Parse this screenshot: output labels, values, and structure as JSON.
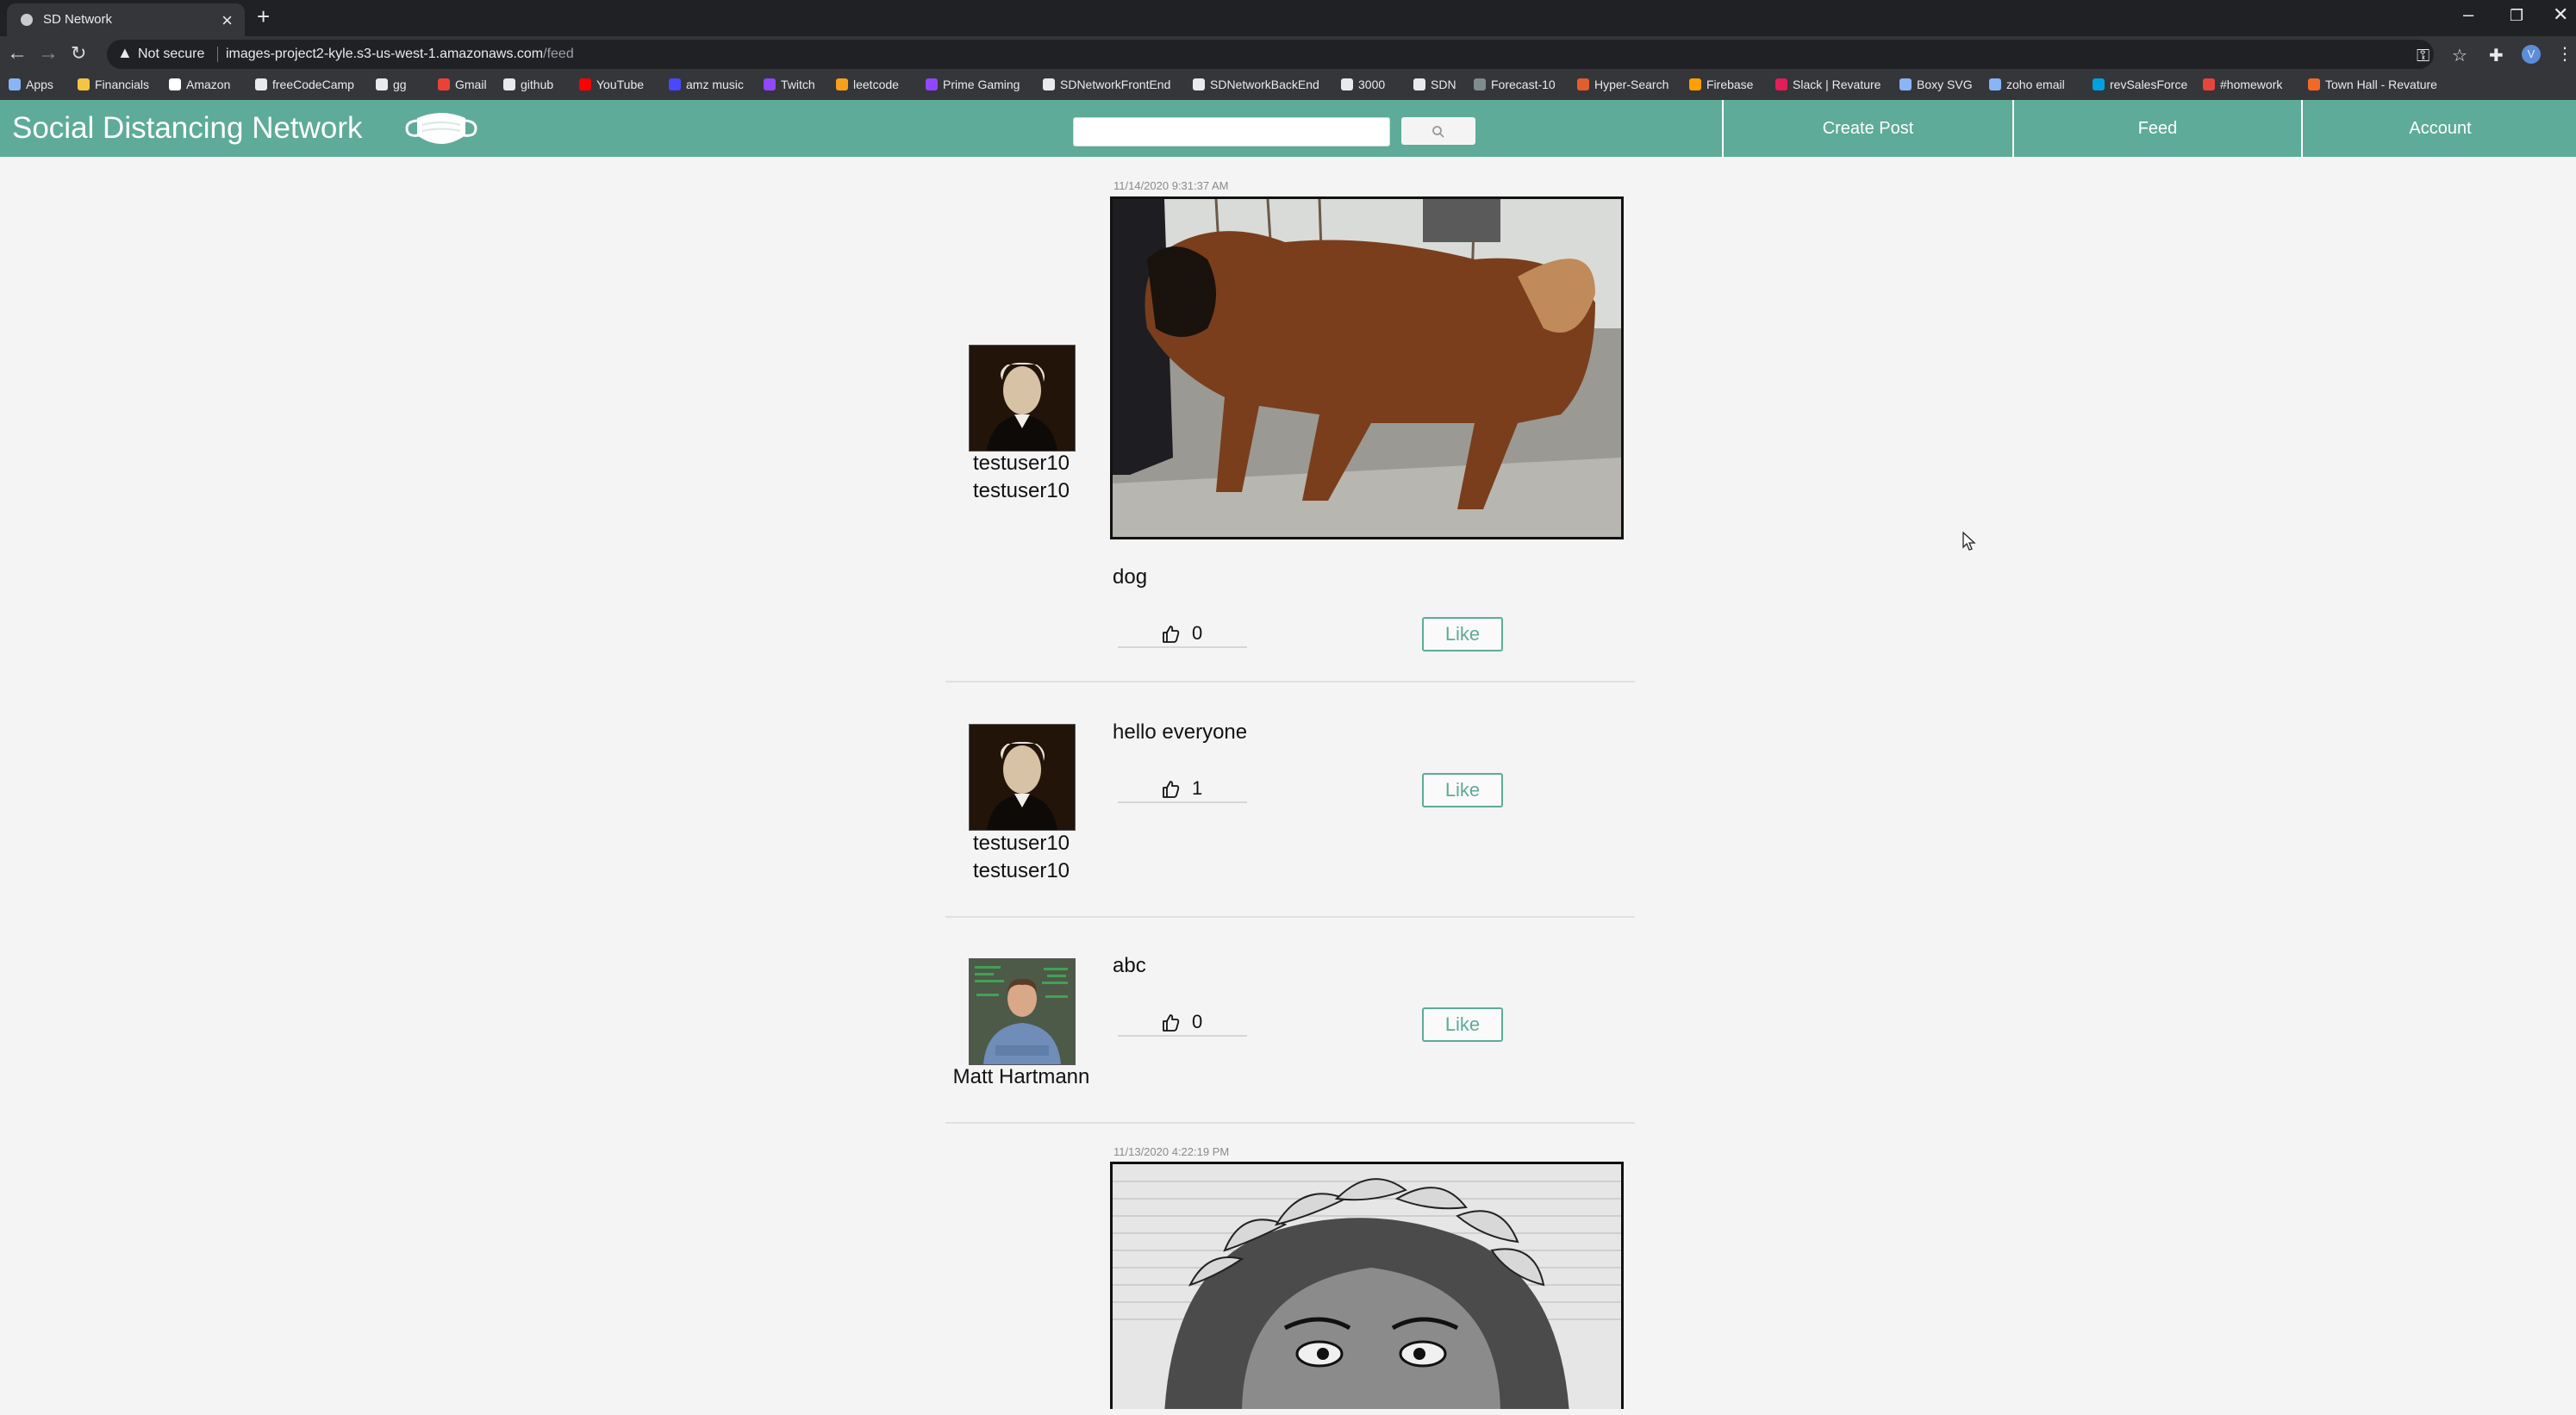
{
  "browser": {
    "tab_title": "SD Network",
    "security": "Not secure",
    "url_host": "images-project2-kyle.s3-us-west-1.amazonaws.com",
    "url_path": "/feed",
    "bookmarks": [
      {
        "label": "Apps",
        "color": "#8ab4f8"
      },
      {
        "label": "Financials",
        "color": "#f4c542"
      },
      {
        "label": "Amazon",
        "color": "#ffffff"
      },
      {
        "label": "freeCodeCamp",
        "color": "#e8eaed"
      },
      {
        "label": "gg",
        "color": "#e8eaed"
      },
      {
        "label": "Gmail",
        "color": "#ea4335"
      },
      {
        "label": "github",
        "color": "#e8eaed"
      },
      {
        "label": "YouTube",
        "color": "#ff0000"
      },
      {
        "label": "amz music",
        "color": "#4a47ff"
      },
      {
        "label": "Twitch",
        "color": "#9146ff"
      },
      {
        "label": "leetcode",
        "color": "#f89f1b"
      },
      {
        "label": "Prime Gaming",
        "color": "#9146ff"
      },
      {
        "label": "SDNetworkFrontEnd",
        "color": "#e8eaed"
      },
      {
        "label": "SDNetworkBackEnd",
        "color": "#e8eaed"
      },
      {
        "label": "3000",
        "color": "#e8eaed"
      },
      {
        "label": "SDN",
        "color": "#e8eaed"
      },
      {
        "label": "Forecast-10",
        "color": "#7f8c8d"
      },
      {
        "label": "Hyper-Search",
        "color": "#e35d2e"
      },
      {
        "label": "Firebase",
        "color": "#ffa000"
      },
      {
        "label": "Slack | Revature",
        "color": "#e01e5a"
      },
      {
        "label": "Boxy SVG",
        "color": "#8ab4f8"
      },
      {
        "label": "zoho email",
        "color": "#8ab4f8"
      },
      {
        "label": "revSalesForce",
        "color": "#00a1e0"
      },
      {
        "label": "#homework",
        "color": "#e8453c"
      },
      {
        "label": "Town Hall - Revature",
        "color": "#f26925"
      }
    ]
  },
  "app": {
    "brand": "Social Distancing Network",
    "search_placeholder": "",
    "nav": {
      "create_post": "Create Post",
      "feed": "Feed",
      "account": "Account"
    },
    "like_label": "Like"
  },
  "posts": [
    {
      "timestamp": "11/14/2020 9:31:37 AM",
      "user": [
        "testuser10",
        "testuser10"
      ],
      "content": "dog",
      "likes": "0",
      "image": "dog-photo"
    },
    {
      "timestamp": "",
      "user": [
        "testuser10",
        "testuser10"
      ],
      "content": "hello everyone",
      "likes": "1",
      "image": ""
    },
    {
      "timestamp": "",
      "user": [
        "Matt Hartmann"
      ],
      "content": "abc",
      "likes": "0",
      "image": ""
    },
    {
      "timestamp": "11/13/2020 4:22:19 PM",
      "user": [],
      "content": "",
      "likes": "",
      "image": "laurel-engraving"
    }
  ]
}
